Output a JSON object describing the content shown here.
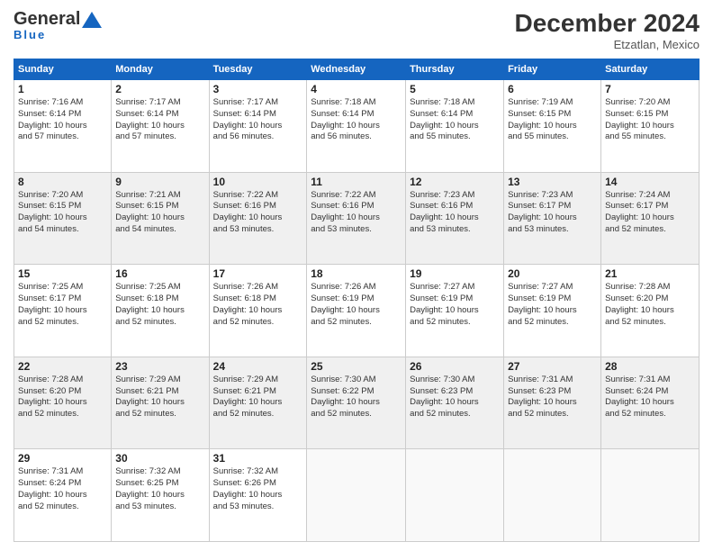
{
  "logo": {
    "general": "General",
    "blue": "Blue"
  },
  "header": {
    "month": "December 2024",
    "location": "Etzatlan, Mexico"
  },
  "weekdays": [
    "Sunday",
    "Monday",
    "Tuesday",
    "Wednesday",
    "Thursday",
    "Friday",
    "Saturday"
  ],
  "weeks": [
    [
      {
        "day": "1",
        "sunrise": "7:16 AM",
        "sunset": "6:14 PM",
        "daylight": "10 hours and 57 minutes."
      },
      {
        "day": "2",
        "sunrise": "7:17 AM",
        "sunset": "6:14 PM",
        "daylight": "10 hours and 57 minutes."
      },
      {
        "day": "3",
        "sunrise": "7:17 AM",
        "sunset": "6:14 PM",
        "daylight": "10 hours and 56 minutes."
      },
      {
        "day": "4",
        "sunrise": "7:18 AM",
        "sunset": "6:14 PM",
        "daylight": "10 hours and 56 minutes."
      },
      {
        "day": "5",
        "sunrise": "7:18 AM",
        "sunset": "6:14 PM",
        "daylight": "10 hours and 55 minutes."
      },
      {
        "day": "6",
        "sunrise": "7:19 AM",
        "sunset": "6:15 PM",
        "daylight": "10 hours and 55 minutes."
      },
      {
        "day": "7",
        "sunrise": "7:20 AM",
        "sunset": "6:15 PM",
        "daylight": "10 hours and 55 minutes."
      }
    ],
    [
      {
        "day": "8",
        "sunrise": "7:20 AM",
        "sunset": "6:15 PM",
        "daylight": "10 hours and 54 minutes."
      },
      {
        "day": "9",
        "sunrise": "7:21 AM",
        "sunset": "6:15 PM",
        "daylight": "10 hours and 54 minutes."
      },
      {
        "day": "10",
        "sunrise": "7:22 AM",
        "sunset": "6:16 PM",
        "daylight": "10 hours and 53 minutes."
      },
      {
        "day": "11",
        "sunrise": "7:22 AM",
        "sunset": "6:16 PM",
        "daylight": "10 hours and 53 minutes."
      },
      {
        "day": "12",
        "sunrise": "7:23 AM",
        "sunset": "6:16 PM",
        "daylight": "10 hours and 53 minutes."
      },
      {
        "day": "13",
        "sunrise": "7:23 AM",
        "sunset": "6:17 PM",
        "daylight": "10 hours and 53 minutes."
      },
      {
        "day": "14",
        "sunrise": "7:24 AM",
        "sunset": "6:17 PM",
        "daylight": "10 hours and 52 minutes."
      }
    ],
    [
      {
        "day": "15",
        "sunrise": "7:25 AM",
        "sunset": "6:17 PM",
        "daylight": "10 hours and 52 minutes."
      },
      {
        "day": "16",
        "sunrise": "7:25 AM",
        "sunset": "6:18 PM",
        "daylight": "10 hours and 52 minutes."
      },
      {
        "day": "17",
        "sunrise": "7:26 AM",
        "sunset": "6:18 PM",
        "daylight": "10 hours and 52 minutes."
      },
      {
        "day": "18",
        "sunrise": "7:26 AM",
        "sunset": "6:19 PM",
        "daylight": "10 hours and 52 minutes."
      },
      {
        "day": "19",
        "sunrise": "7:27 AM",
        "sunset": "6:19 PM",
        "daylight": "10 hours and 52 minutes."
      },
      {
        "day": "20",
        "sunrise": "7:27 AM",
        "sunset": "6:19 PM",
        "daylight": "10 hours and 52 minutes."
      },
      {
        "day": "21",
        "sunrise": "7:28 AM",
        "sunset": "6:20 PM",
        "daylight": "10 hours and 52 minutes."
      }
    ],
    [
      {
        "day": "22",
        "sunrise": "7:28 AM",
        "sunset": "6:20 PM",
        "daylight": "10 hours and 52 minutes."
      },
      {
        "day": "23",
        "sunrise": "7:29 AM",
        "sunset": "6:21 PM",
        "daylight": "10 hours and 52 minutes."
      },
      {
        "day": "24",
        "sunrise": "7:29 AM",
        "sunset": "6:21 PM",
        "daylight": "10 hours and 52 minutes."
      },
      {
        "day": "25",
        "sunrise": "7:30 AM",
        "sunset": "6:22 PM",
        "daylight": "10 hours and 52 minutes."
      },
      {
        "day": "26",
        "sunrise": "7:30 AM",
        "sunset": "6:23 PM",
        "daylight": "10 hours and 52 minutes."
      },
      {
        "day": "27",
        "sunrise": "7:31 AM",
        "sunset": "6:23 PM",
        "daylight": "10 hours and 52 minutes."
      },
      {
        "day": "28",
        "sunrise": "7:31 AM",
        "sunset": "6:24 PM",
        "daylight": "10 hours and 52 minutes."
      }
    ],
    [
      {
        "day": "29",
        "sunrise": "7:31 AM",
        "sunset": "6:24 PM",
        "daylight": "10 hours and 52 minutes."
      },
      {
        "day": "30",
        "sunrise": "7:32 AM",
        "sunset": "6:25 PM",
        "daylight": "10 hours and 53 minutes."
      },
      {
        "day": "31",
        "sunrise": "7:32 AM",
        "sunset": "6:26 PM",
        "daylight": "10 hours and 53 minutes."
      },
      null,
      null,
      null,
      null
    ]
  ],
  "labels": {
    "sunrise": "Sunrise:",
    "sunset": "Sunset:",
    "daylight": "Daylight:"
  }
}
